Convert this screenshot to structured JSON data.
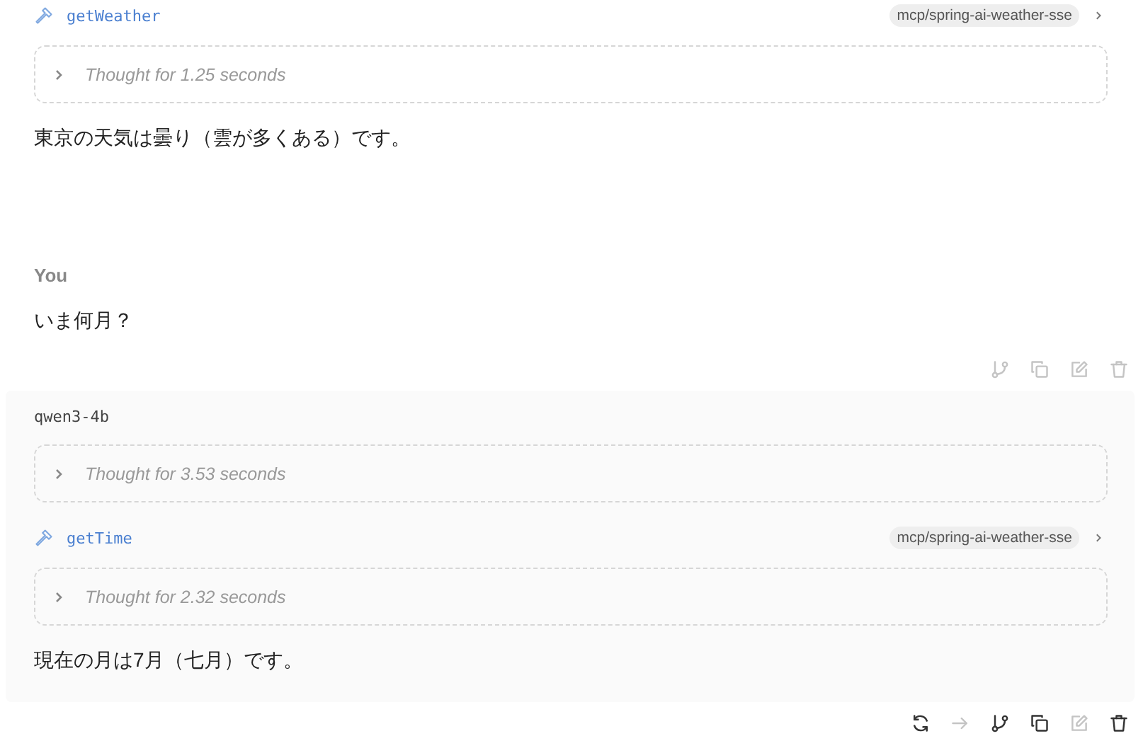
{
  "messages": [
    {
      "kind": "assistant",
      "highlighted": false,
      "blocks": [
        {
          "kind": "tool",
          "name": "getWeather",
          "server": "mcp/spring-ai-weather-sse"
        },
        {
          "kind": "thought",
          "text": "Thought for 1.25 seconds"
        },
        {
          "kind": "text",
          "text": "東京の天気は曇り（雲が多くある）です。"
        }
      ]
    },
    {
      "kind": "user",
      "author": "You",
      "highlighted": false,
      "blocks": [
        {
          "kind": "text",
          "text": "いま何月？"
        }
      ],
      "actions": [
        {
          "kind": "branch",
          "disabled": true
        },
        {
          "kind": "copy",
          "disabled": true
        },
        {
          "kind": "edit",
          "disabled": true
        },
        {
          "kind": "delete",
          "disabled": true
        }
      ]
    },
    {
      "kind": "assistant",
      "model": "qwen3-4b",
      "highlighted": true,
      "blocks": [
        {
          "kind": "thought",
          "text": "Thought for 3.53 seconds"
        },
        {
          "kind": "tool",
          "name": "getTime",
          "server": "mcp/spring-ai-weather-sse"
        },
        {
          "kind": "thought",
          "text": "Thought for 2.32 seconds"
        },
        {
          "kind": "text",
          "text": "現在の月は7月（七月）です。"
        }
      ],
      "actions": [
        {
          "kind": "regenerate",
          "disabled": false
        },
        {
          "kind": "next",
          "disabled": true
        },
        {
          "kind": "branch",
          "disabled": false
        },
        {
          "kind": "copy",
          "disabled": false
        },
        {
          "kind": "edit",
          "disabled": true
        },
        {
          "kind": "delete",
          "disabled": false
        }
      ]
    }
  ]
}
